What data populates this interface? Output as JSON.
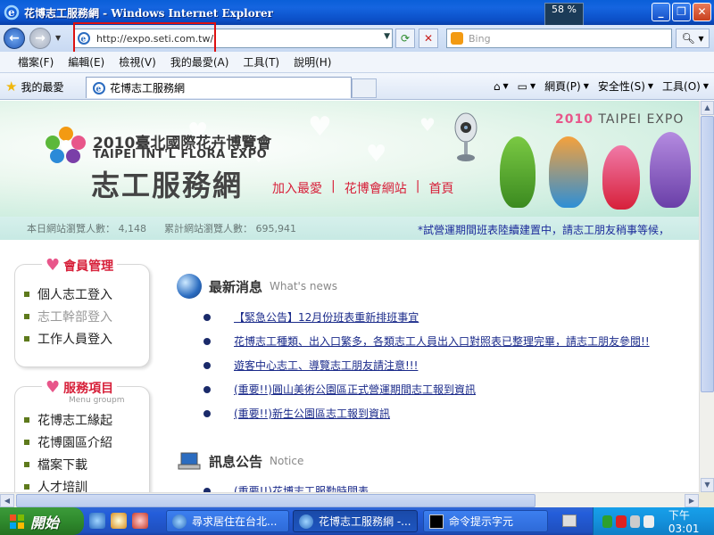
{
  "window": {
    "title": "花博志工服務網 - Windows Internet Explorer",
    "cpu_label": "58 %"
  },
  "address": {
    "url": "http://expo.seti.com.tw/",
    "search_placeholder": "Bing"
  },
  "menu": [
    {
      "label": "檔案(F)"
    },
    {
      "label": "編輯(E)"
    },
    {
      "label": "檢視(V)"
    },
    {
      "label": "我的最愛(A)"
    },
    {
      "label": "工具(T)"
    },
    {
      "label": "說明(H)"
    }
  ],
  "favbar": {
    "favorites_label": "我的最愛",
    "tab_title": "花博志工服務網",
    "cmd_page": "網頁(P)",
    "cmd_safety": "安全性(S)",
    "cmd_tools": "工具(O)"
  },
  "banner": {
    "expo_title": "2010臺北國際花卉博覽會",
    "expo_subtitle": "TAIPEI INT'L FLORA EXPO",
    "site_title": "志工服務網",
    "badge_year": "2010",
    "badge_text": "TAIPEI EXPO",
    "links": [
      {
        "label": "加入最愛"
      },
      {
        "label": "花博會網站"
      },
      {
        "label": "首頁"
      }
    ]
  },
  "stats": {
    "today": "本日網站瀏覽人數： 4,148",
    "total": "累計網站瀏覽人數： 695,941",
    "ticker": "*試營運期間班表陸續建置中，請志工朋友稍事等候，"
  },
  "sidebar": {
    "member": {
      "title": "會員管理",
      "items": [
        {
          "label": "個人志工登入",
          "enabled": true
        },
        {
          "label": "志工幹部登入",
          "enabled": false
        },
        {
          "label": "工作人員登入",
          "enabled": true
        }
      ]
    },
    "services": {
      "title": "服務項目",
      "subtitle": "Menu groupm",
      "items": [
        {
          "label": "花博志工緣起"
        },
        {
          "label": "花博園區介紹"
        },
        {
          "label": "檔案下載"
        },
        {
          "label": "人才培訓"
        }
      ]
    }
  },
  "news": {
    "title": "最新消息",
    "title_en": "What's news",
    "items": [
      {
        "label": "【緊急公告】12月份班表重新排班事宜"
      },
      {
        "label": "花博志工種類、出入口繁多，各類志工人員出入口對照表已整理完畢，請志工朋友參閱!!"
      },
      {
        "label": "遊客中心志工、導覽志工朋友請注意!!!"
      },
      {
        "label": "(重要!!)圓山美術公園區正式營運期間志工報到資訊"
      },
      {
        "label": "(重要!!)新生公園區志工報到資訊"
      }
    ]
  },
  "notice": {
    "title": "訊息公告",
    "title_en": "Notice",
    "items": [
      {
        "label": "(重要!!)花博志工服勤時間表"
      }
    ]
  },
  "taskbar": {
    "start_label": "開始",
    "tasks": [
      {
        "label": "尋求居住在台北..."
      },
      {
        "label": "花博志工服務網 -..."
      },
      {
        "label": "命令提示字元"
      }
    ],
    "clock": "下午 03:01"
  },
  "colors": {
    "accent_red": "#d7203a",
    "link_blue": "#1a2a8a",
    "xp_blue": "#245edb",
    "start_green": "#2f8a2d"
  }
}
